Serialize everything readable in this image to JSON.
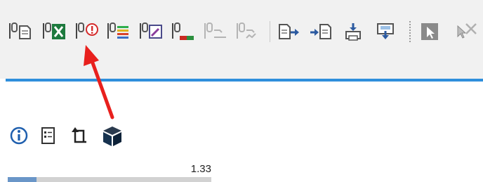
{
  "toolbar": {
    "buttons": [
      {
        "id": "report",
        "icon": "report-page-icon"
      },
      {
        "id": "excel",
        "icon": "excel-export-icon"
      },
      {
        "id": "info",
        "icon": "info-circle-icon",
        "highlighted": true
      },
      {
        "id": "color-scale",
        "icon": "color-scale-icon"
      },
      {
        "id": "edit",
        "icon": "edit-frame-icon"
      },
      {
        "id": "color-bar",
        "icon": "color-bar-icon"
      },
      {
        "id": "disabled-1",
        "icon": "chart-disabled-icon",
        "enabled": false
      },
      {
        "id": "disabled-2",
        "icon": "chart-disabled-icon",
        "enabled": false
      },
      {
        "id": "export-to",
        "icon": "export-arrow-icon"
      },
      {
        "id": "import-from",
        "icon": "import-arrow-icon"
      },
      {
        "id": "print",
        "icon": "printer-icon"
      },
      {
        "id": "save-down",
        "icon": "save-download-icon"
      },
      {
        "id": "select",
        "icon": "select-cursor-icon"
      },
      {
        "id": "pick",
        "icon": "pick-cursor-icon"
      }
    ]
  },
  "annotation": {
    "color": "#e8201d"
  },
  "panel": {
    "icons": [
      "info-icon",
      "properties-sheet-icon",
      "new-item-icon",
      "3d-box-icon"
    ],
    "value_label": "1.33",
    "progress_fraction": 0.14
  },
  "colors": {
    "accent": "#2f8fdc",
    "arrow": "#e8201d",
    "toolbar_bg": "#f1f1f1"
  }
}
